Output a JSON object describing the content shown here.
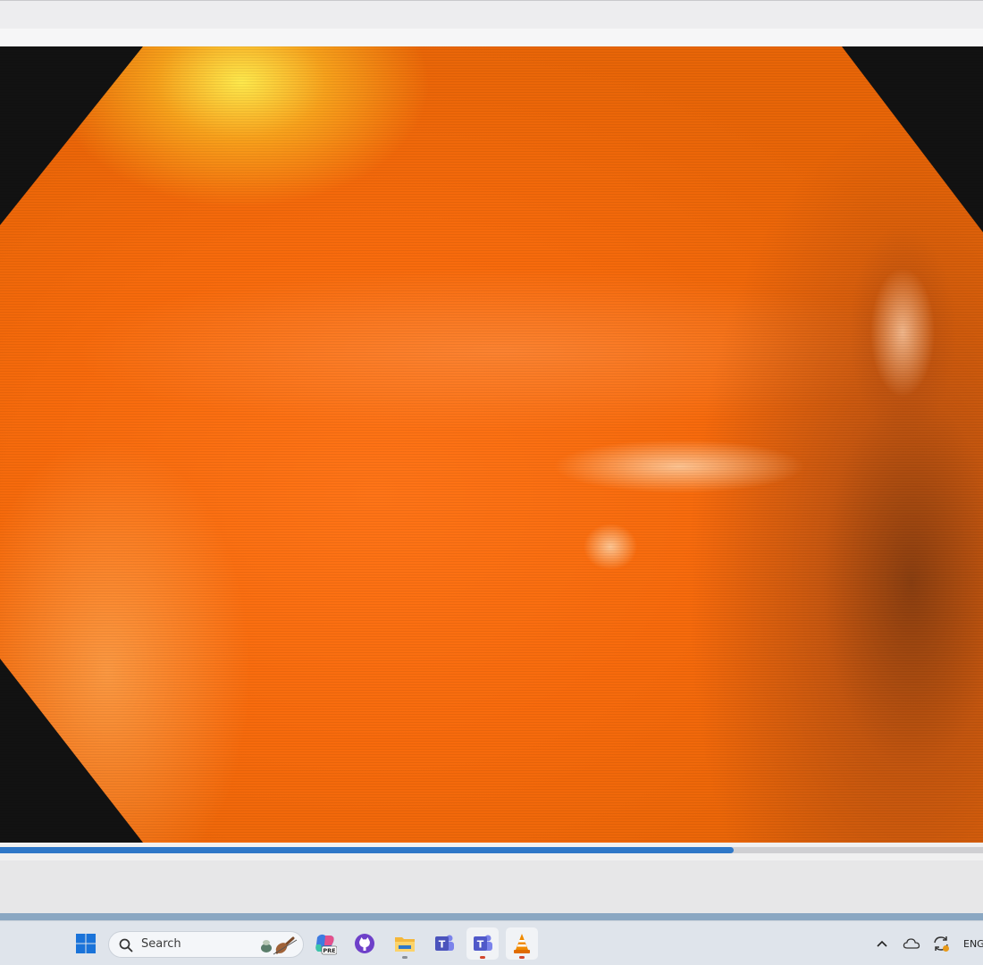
{
  "player": {
    "playback_progress": 0.746,
    "seek_fill_color": "#2f78c8",
    "video_description_icon": "video-frame"
  },
  "taskbar": {
    "start_icon": "windows-start-icon",
    "search": {
      "placeholder": "Search",
      "icon": "search-icon"
    },
    "pinned": [
      {
        "name": "copilot-pre-icon",
        "badge": "PRE"
      },
      {
        "name": "github-icon"
      },
      {
        "name": "file-explorer-icon"
      },
      {
        "name": "teams-classic-icon"
      },
      {
        "name": "teams-icon"
      },
      {
        "name": "vlc-icon"
      }
    ],
    "tray": {
      "overflow_icon": "chevron-up-icon",
      "onedrive_icon": "cloud-icon",
      "sync_icon": "sync-icon",
      "language": "ENG"
    }
  }
}
